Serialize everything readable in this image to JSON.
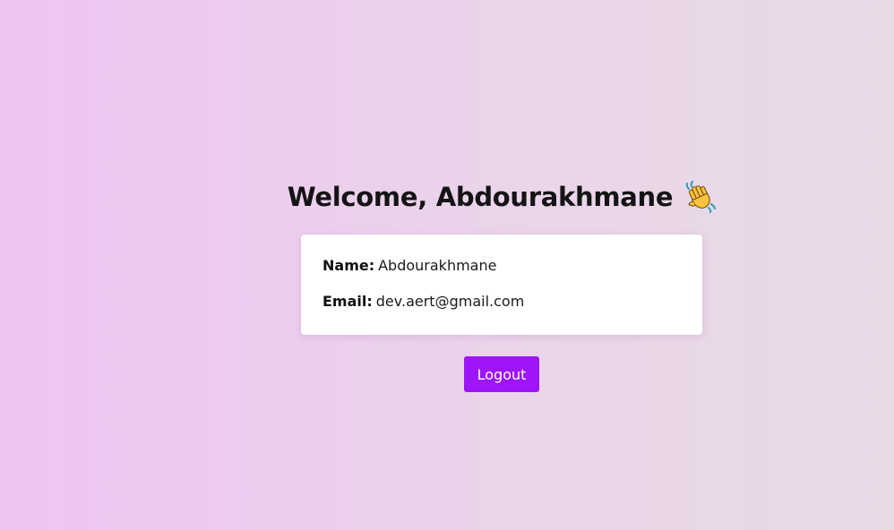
{
  "header": {
    "title": "Welcome, Abdourakhmane",
    "icon": "waving-hand-icon"
  },
  "profile": {
    "name_label": "Name:",
    "name_value": "Abdourakhmane",
    "email_label": "Email:",
    "email_value": "dev.aert@gmail.com"
  },
  "actions": {
    "logout_label": "Logout"
  },
  "colors": {
    "background_start": "#eec4f1",
    "background_end": "#e8dbe6",
    "button": "#9d15f8",
    "card": "#ffffff"
  }
}
